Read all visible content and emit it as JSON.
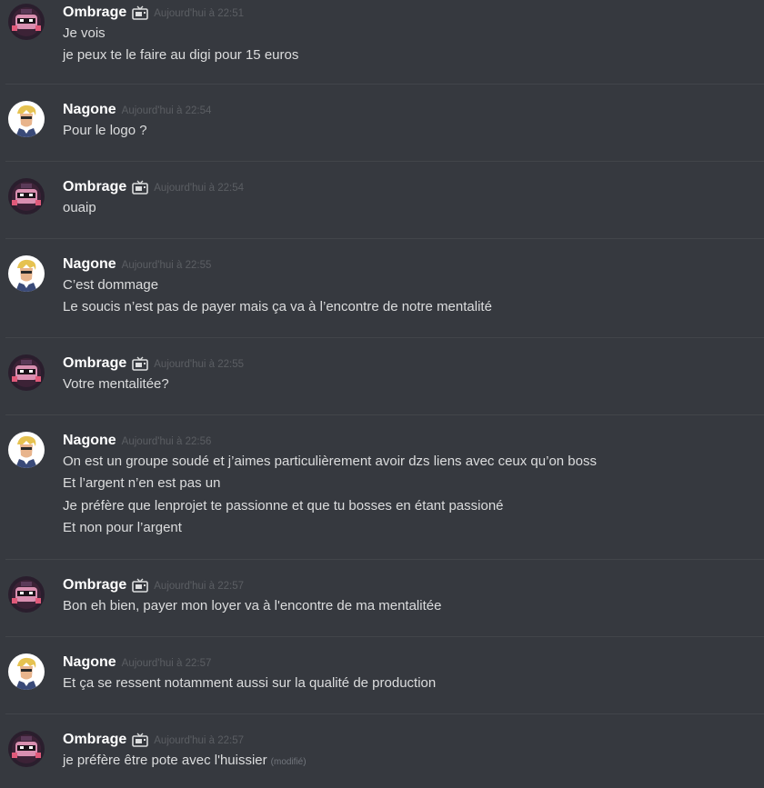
{
  "messages": [
    {
      "author": "Ombrage",
      "avatar_icon": "ombrage-avatar-icon",
      "badge_icon": "tv-icon",
      "timestamp": "Aujourd'hui à 22:51",
      "lines": [
        "Je vois",
        "je peux te le faire au digi pour 15 euros"
      ]
    },
    {
      "author": "Nagone",
      "avatar_icon": "nagone-avatar-icon",
      "timestamp": "Aujourd'hui à 22:54",
      "lines": [
        "Pour le logo ?"
      ]
    },
    {
      "author": "Ombrage",
      "avatar_icon": "ombrage-avatar-icon",
      "badge_icon": "tv-icon",
      "timestamp": "Aujourd'hui à 22:54",
      "lines": [
        "ouaip"
      ]
    },
    {
      "author": "Nagone",
      "avatar_icon": "nagone-avatar-icon",
      "timestamp": "Aujourd'hui à 22:55",
      "lines": [
        "C’est dommage",
        "Le soucis n’est pas de payer mais ça va à l’encontre de notre mentalité"
      ]
    },
    {
      "author": "Ombrage",
      "avatar_icon": "ombrage-avatar-icon",
      "badge_icon": "tv-icon",
      "timestamp": "Aujourd'hui à 22:55",
      "lines": [
        "Votre mentalitée?"
      ]
    },
    {
      "author": "Nagone",
      "avatar_icon": "nagone-avatar-icon",
      "timestamp": "Aujourd'hui à 22:56",
      "lines": [
        "On est un groupe soudé et j’aimes particulièrement avoir dzs liens avec ceux qu’on boss",
        "Et l’argent n’en est pas un",
        "Je préfère que lenprojet te passionne et que tu bosses en étant passioné",
        "Et non pour l’argent"
      ]
    },
    {
      "author": "Ombrage",
      "avatar_icon": "ombrage-avatar-icon",
      "badge_icon": "tv-icon",
      "timestamp": "Aujourd'hui à 22:57",
      "lines": [
        "Bon eh bien, payer mon loyer va à l'encontre de ma mentalitée"
      ]
    },
    {
      "author": "Nagone",
      "avatar_icon": "nagone-avatar-icon",
      "timestamp": "Aujourd'hui à 22:57",
      "lines": [
        "Et ça se ressent notamment aussi sur la qualité de production"
      ]
    },
    {
      "author": "Ombrage",
      "avatar_icon": "ombrage-avatar-icon",
      "badge_icon": "tv-icon",
      "timestamp": "Aujourd'hui à 22:57",
      "lines": [
        "je préfère être pote avec l'huissier"
      ],
      "edited_label": "(modifié)"
    }
  ],
  "colors": {
    "background": "#36393f",
    "divider": "#42454a",
    "author": "#ffffff",
    "timestamp": "#5b5e63",
    "text": "#dcddde"
  }
}
